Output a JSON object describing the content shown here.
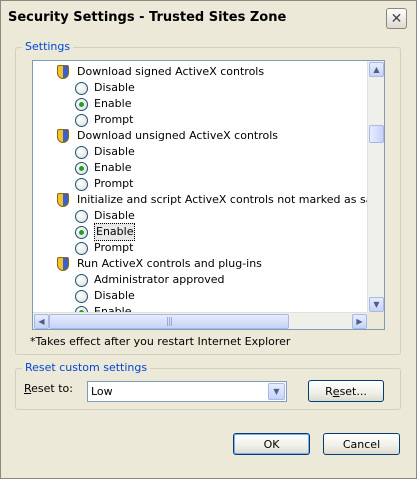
{
  "window": {
    "title": "Security Settings - Trusted Sites Zone",
    "close_glyph": "✕"
  },
  "settings_group": {
    "legend": "Settings"
  },
  "settings_list": [
    {
      "type": "header",
      "label": "Download signed ActiveX controls"
    },
    {
      "type": "option",
      "label": "Disable",
      "checked": false
    },
    {
      "type": "option",
      "label": "Enable",
      "checked": true
    },
    {
      "type": "option",
      "label": "Prompt",
      "checked": false
    },
    {
      "type": "header",
      "label": "Download unsigned ActiveX controls"
    },
    {
      "type": "option",
      "label": "Disable",
      "checked": false
    },
    {
      "type": "option",
      "label": "Enable",
      "checked": true
    },
    {
      "type": "option",
      "label": "Prompt",
      "checked": false
    },
    {
      "type": "header",
      "label": "Initialize and script ActiveX controls not marked as safe for sc"
    },
    {
      "type": "option",
      "label": "Disable",
      "checked": false
    },
    {
      "type": "option",
      "label": "Enable",
      "checked": true,
      "focused": true
    },
    {
      "type": "option",
      "label": "Prompt",
      "checked": false
    },
    {
      "type": "header",
      "label": "Run ActiveX controls and plug-ins"
    },
    {
      "type": "option",
      "label": "Administrator approved",
      "checked": false
    },
    {
      "type": "option",
      "label": "Disable",
      "checked": false
    },
    {
      "type": "option",
      "label": "Enable",
      "checked": true
    }
  ],
  "scrollbars": {
    "up_glyph": "▲",
    "down_glyph": "▼",
    "left_glyph": "◀",
    "right_glyph": "▶",
    "grip_glyph": "|||"
  },
  "note": "*Takes effect after you restart Internet Explorer",
  "reset_group": {
    "legend": "Reset custom settings",
    "reset_to_prefix": "R",
    "reset_to_rest": "eset to:",
    "selected_value": "Low",
    "dropdown_glyph": "▼",
    "reset_button_prefix": "R",
    "reset_button_underlined": "e",
    "reset_button_rest": "set..."
  },
  "buttons": {
    "ok": "OK",
    "cancel": "Cancel"
  },
  "colors": {
    "accent": "#0046d5",
    "radio_dot": "#21a121"
  }
}
